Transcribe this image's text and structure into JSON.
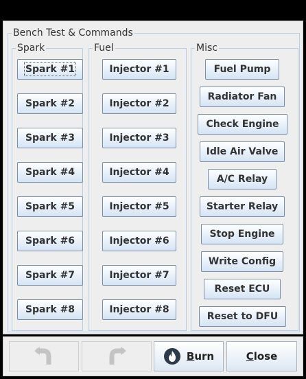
{
  "panel": {
    "title": "Bench Test & Commands"
  },
  "spark": {
    "title": "Spark",
    "buttons": [
      "Spark #1",
      "Spark #2",
      "Spark #3",
      "Spark #4",
      "Spark #5",
      "Spark #6",
      "Spark #7",
      "Spark #8"
    ]
  },
  "fuel": {
    "title": "Fuel",
    "buttons": [
      "Injector #1",
      "Injector #2",
      "Injector #3",
      "Injector #4",
      "Injector #5",
      "Injector #6",
      "Injector #7",
      "Injector #8"
    ]
  },
  "misc": {
    "title": "Misc",
    "buttons": [
      "Fuel Pump",
      "Radiator Fan",
      "Check Engine",
      "Idle Air Valve",
      "A/C Relay",
      "Starter Relay",
      "Stop Engine",
      "Write Config",
      "Reset ECU",
      "Reset to DFU"
    ]
  },
  "bottom": {
    "undo_icon": "undo-arrow-icon",
    "redo_icon": "redo-arrow-icon",
    "burn_icon": "flame-icon",
    "burn_mnemonic": "B",
    "burn_rest": "urn",
    "close_mnemonic": "C",
    "close_rest": "lose"
  },
  "colors": {
    "group_border": "#b8cfe5",
    "button_border": "#7a8ea5",
    "background": "#eeeeee"
  }
}
